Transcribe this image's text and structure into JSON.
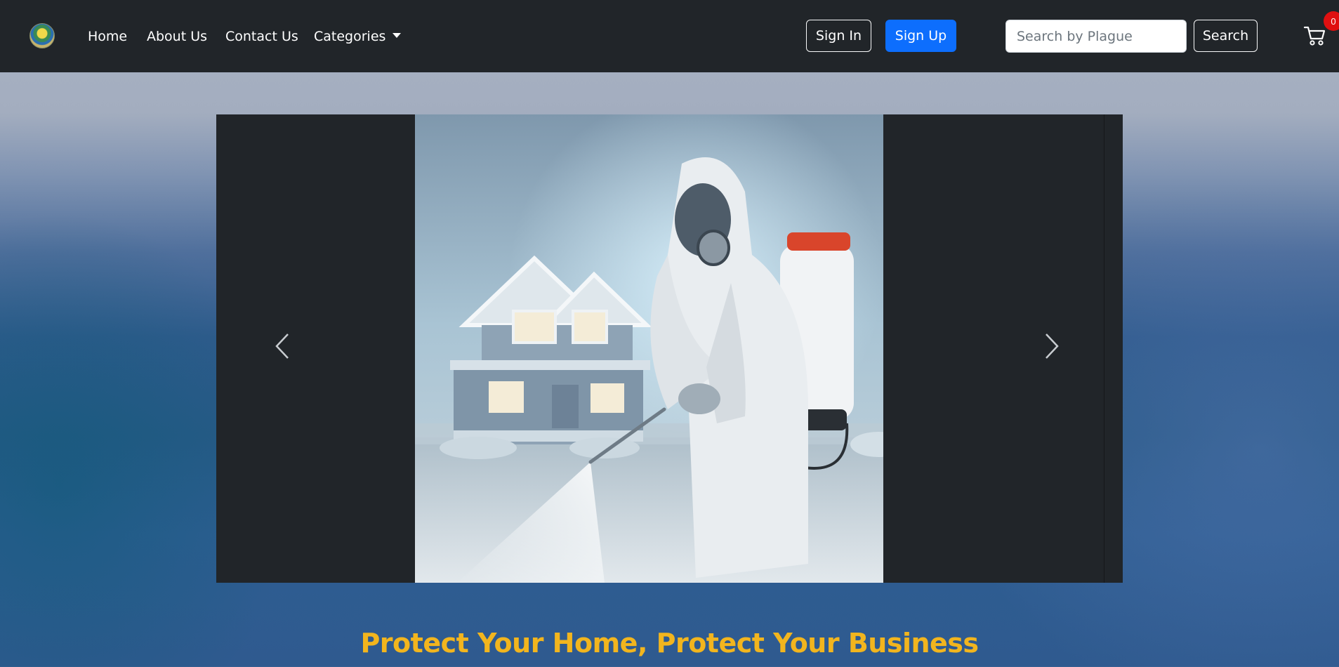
{
  "navbar": {
    "logo_icon": "pest-control-logo",
    "links": [
      {
        "label": "Home"
      },
      {
        "label": "About Us"
      },
      {
        "label": "Contact Us"
      }
    ],
    "dropdown": {
      "label": "Categories"
    },
    "auth": {
      "sign_in_label": "Sign In",
      "sign_up_label": "Sign Up"
    },
    "search": {
      "placeholder": "Search by Plague",
      "value": "",
      "button_label": "Search"
    },
    "cart": {
      "icon": "shopping-cart-icon",
      "count": "0"
    }
  },
  "carousel": {
    "slide_image": "exterminator in protective suit spraying pesticide in front of a house",
    "prev_icon": "chevron-left-icon",
    "next_icon": "chevron-right-icon"
  },
  "hero": {
    "headline": "Protect Your Home, Protect Your Business"
  },
  "colors": {
    "navbar_bg": "#212529",
    "primary": "#0d6efd",
    "headline": "#f2b51e",
    "badge": "#e01010"
  }
}
